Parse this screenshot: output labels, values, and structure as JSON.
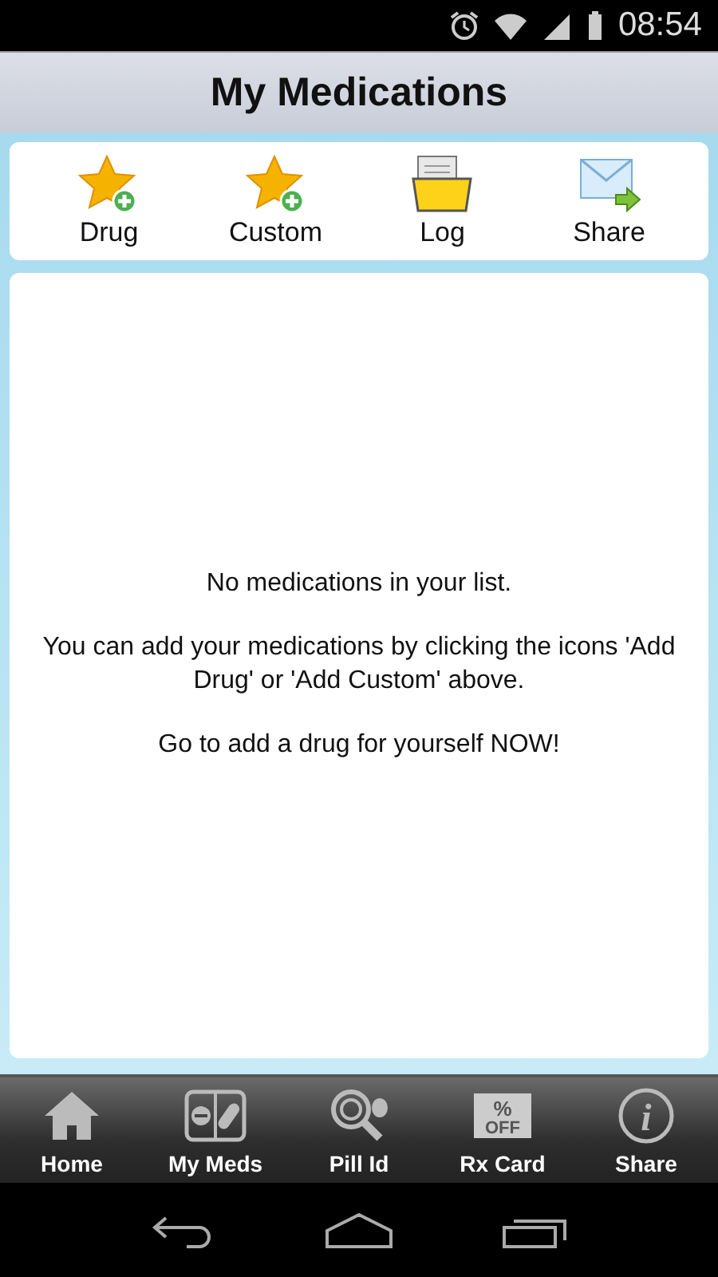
{
  "status_bar": {
    "time": "08:54"
  },
  "title": "My Medications",
  "actions": [
    {
      "label": "Drug",
      "kind": "star-add"
    },
    {
      "label": "Custom",
      "kind": "star-add"
    },
    {
      "label": "Log",
      "kind": "folder"
    },
    {
      "label": "Share",
      "kind": "mail"
    }
  ],
  "empty_message": [
    "No medications in your list.",
    "You can add your medications by clicking the icons 'Add Drug' or 'Add Custom' above.",
    "Go to add a drug for yourself NOW!"
  ],
  "bottom_tabs": [
    {
      "label": "Home",
      "kind": "home"
    },
    {
      "label": "My Meds",
      "kind": "pills"
    },
    {
      "label": "Pill Id",
      "kind": "magnifier"
    },
    {
      "label": "Rx Card",
      "kind": "coupon",
      "icon_text": [
        "%",
        "OFF"
      ]
    },
    {
      "label": "Share",
      "kind": "info",
      "icon_text": [
        "i"
      ]
    }
  ]
}
